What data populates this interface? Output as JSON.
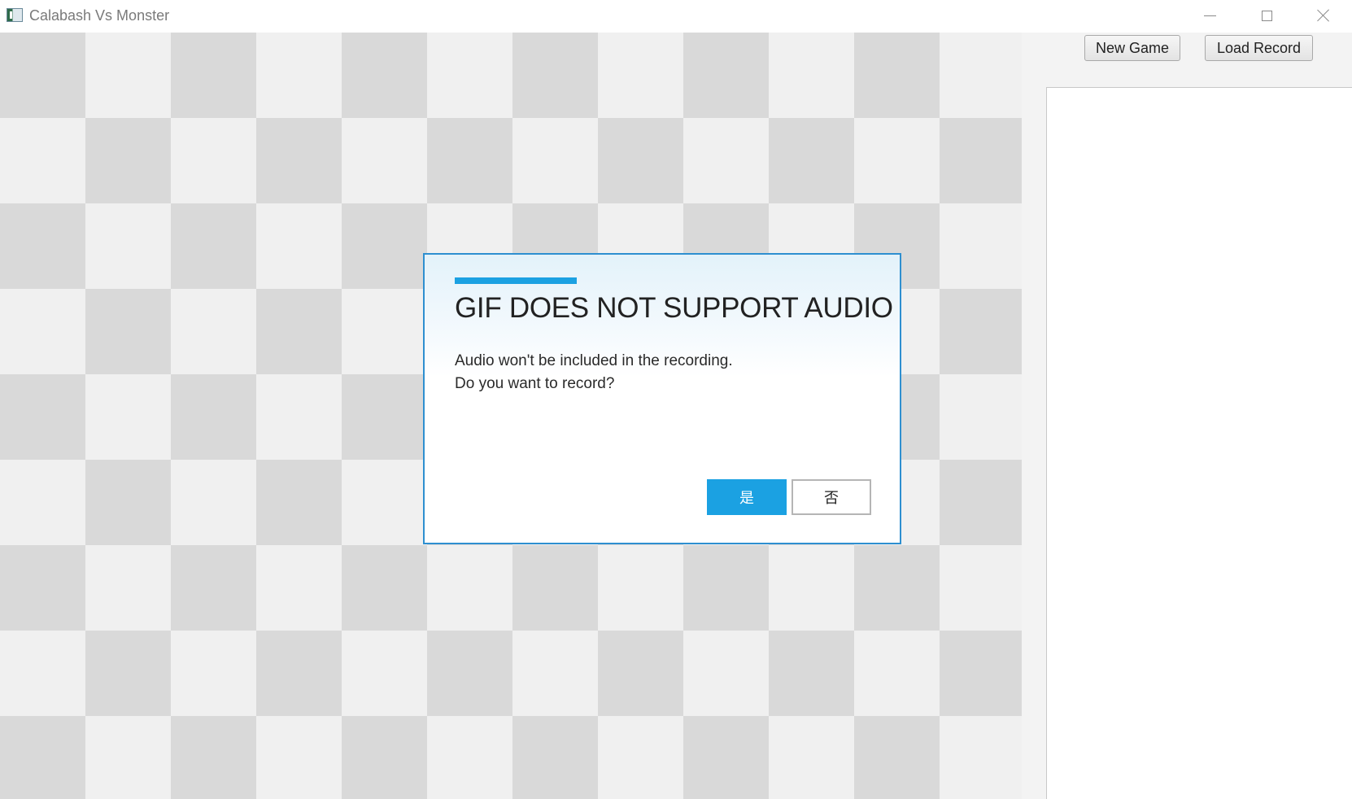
{
  "window": {
    "title": "Calabash Vs Monster"
  },
  "toolbar": {
    "new_game_label": "New Game",
    "load_record_label": "Load Record"
  },
  "dialog": {
    "title": "GIF DOES NOT SUPPORT AUDIO",
    "message_line1": "Audio won't be included in the recording.",
    "message_line2": "Do you want to record?",
    "yes_label": "是",
    "no_label": "否"
  },
  "colors": {
    "accent": "#1ba1e2",
    "dialog_border": "#2e8fd0",
    "board_light": "#f0f0f0",
    "board_dark": "#d9d9d9"
  },
  "icons": {
    "app": "app-window-icon",
    "minimize": "minimize-icon",
    "maximize": "maximize-icon",
    "close": "close-icon"
  }
}
